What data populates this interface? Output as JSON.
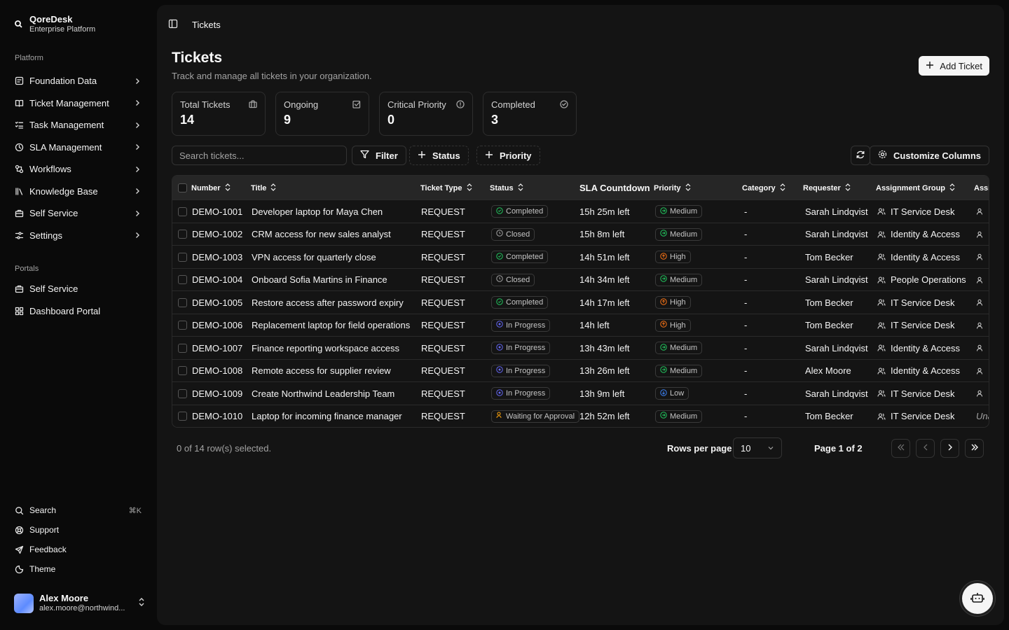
{
  "brand": {
    "name": "QoreDesk",
    "subtitle": "Enterprise Platform"
  },
  "sidebar": {
    "platform_label": "Platform",
    "platform_items": [
      {
        "label": "Foundation Data",
        "icon": "database-icon"
      },
      {
        "label": "Ticket Management",
        "icon": "book-icon"
      },
      {
        "label": "Task Management",
        "icon": "list-checks-icon"
      },
      {
        "label": "SLA Management",
        "icon": "clock-icon"
      },
      {
        "label": "Workflows",
        "icon": "workflow-icon"
      },
      {
        "label": "Knowledge Base",
        "icon": "library-icon"
      },
      {
        "label": "Self Service",
        "icon": "briefcase-icon"
      },
      {
        "label": "Settings",
        "icon": "sliders-icon"
      }
    ],
    "portals_label": "Portals",
    "portal_items": [
      {
        "label": "Self Service",
        "icon": "briefcase-icon"
      },
      {
        "label": "Dashboard Portal",
        "icon": "grid-icon"
      }
    ],
    "bottom_items": [
      {
        "label": "Search",
        "icon": "search-icon",
        "shortcut": "⌘K"
      },
      {
        "label": "Support",
        "icon": "lifebuoy-icon"
      },
      {
        "label": "Feedback",
        "icon": "send-icon"
      },
      {
        "label": "Theme",
        "icon": "theme-icon"
      }
    ],
    "user": {
      "name": "Alex Moore",
      "email": "alex.moore@northwind..."
    }
  },
  "header": {
    "breadcrumb": "Tickets"
  },
  "page": {
    "title": "Tickets",
    "subtitle": "Track and manage all tickets in your organization.",
    "add_button": "Add Ticket"
  },
  "stats": [
    {
      "label": "Total Tickets",
      "value": "14",
      "icon": "ticket-icon"
    },
    {
      "label": "Ongoing",
      "value": "9",
      "icon": "edit-square-icon"
    },
    {
      "label": "Critical Priority",
      "value": "0",
      "icon": "alert-circle-icon"
    },
    {
      "label": "Completed",
      "value": "3",
      "icon": "check-circle-icon"
    }
  ],
  "toolbar": {
    "search_placeholder": "Search tickets...",
    "filter_label": "Filter",
    "status_label": "Status",
    "priority_label": "Priority",
    "customize_label": "Customize Columns"
  },
  "table": {
    "columns": {
      "number": "Number",
      "title": "Title",
      "ticket_type": "Ticket Type",
      "status": "Status",
      "sla": "SLA Countdown",
      "priority": "Priority",
      "category": "Category",
      "requester": "Requester",
      "assignment_group": "Assignment Group",
      "assignee": "Assi"
    },
    "rows": [
      {
        "number": "DEMO-1001",
        "title": "Developer laptop for Maya Chen",
        "type": "REQUEST",
        "status": "Completed",
        "sla": "15h 25m left",
        "priority": "Medium",
        "category": "-",
        "requester": "Sarah Lindqvist",
        "group": "IT Service Desk",
        "assignee": ""
      },
      {
        "number": "DEMO-1002",
        "title": "CRM access for new sales analyst",
        "type": "REQUEST",
        "status": "Closed",
        "sla": "15h 8m left",
        "priority": "Medium",
        "category": "-",
        "requester": "Sarah Lindqvist",
        "group": "Identity & Access",
        "assignee": ""
      },
      {
        "number": "DEMO-1003",
        "title": "VPN access for quarterly close",
        "type": "REQUEST",
        "status": "Completed",
        "sla": "14h 51m left",
        "priority": "High",
        "category": "-",
        "requester": "Tom Becker",
        "group": "Identity & Access",
        "assignee": ""
      },
      {
        "number": "DEMO-1004",
        "title": "Onboard Sofia Martins in Finance",
        "type": "REQUEST",
        "status": "Closed",
        "sla": "14h 34m left",
        "priority": "Medium",
        "category": "-",
        "requester": "Sarah Lindqvist",
        "group": "People Operations",
        "assignee": ""
      },
      {
        "number": "DEMO-1005",
        "title": "Restore access after password expiry",
        "type": "REQUEST",
        "status": "Completed",
        "sla": "14h 17m left",
        "priority": "High",
        "category": "-",
        "requester": "Tom Becker",
        "group": "IT Service Desk",
        "assignee": ""
      },
      {
        "number": "DEMO-1006",
        "title": "Replacement laptop for field operations",
        "type": "REQUEST",
        "status": "In Progress",
        "sla": "14h left",
        "priority": "High",
        "category": "-",
        "requester": "Tom Becker",
        "group": "IT Service Desk",
        "assignee": ""
      },
      {
        "number": "DEMO-1007",
        "title": "Finance reporting workspace access",
        "type": "REQUEST",
        "status": "In Progress",
        "sla": "13h 43m left",
        "priority": "Medium",
        "category": "-",
        "requester": "Sarah Lindqvist",
        "group": "Identity & Access",
        "assignee": ""
      },
      {
        "number": "DEMO-1008",
        "title": "Remote access for supplier review",
        "type": "REQUEST",
        "status": "In Progress",
        "sla": "13h 26m left",
        "priority": "Medium",
        "category": "-",
        "requester": "Alex Moore",
        "group": "Identity & Access",
        "assignee": ""
      },
      {
        "number": "DEMO-1009",
        "title": "Create Northwind Leadership Team",
        "type": "REQUEST",
        "status": "In Progress",
        "sla": "13h 9m left",
        "priority": "Low",
        "category": "-",
        "requester": "Sarah Lindqvist",
        "group": "IT Service Desk",
        "assignee": ""
      },
      {
        "number": "DEMO-1010",
        "title": "Laptop for incoming finance manager",
        "type": "REQUEST",
        "status": "Waiting for Approval",
        "sla": "12h 52m left",
        "priority": "Medium",
        "category": "-",
        "requester": "Tom Becker",
        "group": "IT Service Desk",
        "assignee": "Una"
      }
    ]
  },
  "pagination": {
    "selected_text": "0 of 14 row(s) selected.",
    "rows_per_page_label": "Rows per page",
    "rows_per_page_value": "10",
    "page_label": "Page 1 of 2"
  },
  "colors": {
    "completed": "#22c55e",
    "closed": "#a3a3a3",
    "in_progress": "#6366f1",
    "waiting": "#f59e0b",
    "medium": "#22c55e",
    "high": "#f97316",
    "low": "#3b82f6"
  }
}
